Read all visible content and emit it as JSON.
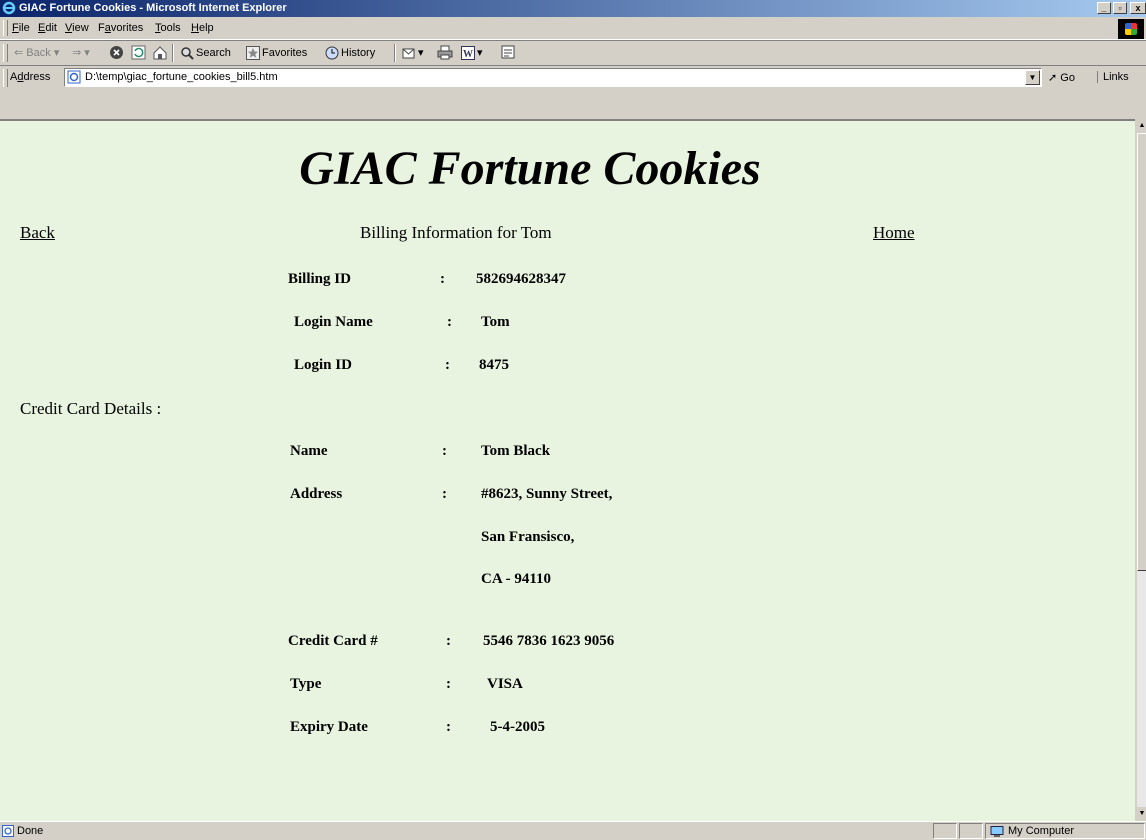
{
  "window": {
    "title": "GIAC Fortune Cookies - Microsoft Internet Explorer"
  },
  "menu": [
    {
      "accel": "F",
      "rest": "ile"
    },
    {
      "accel": "E",
      "rest": "dit"
    },
    {
      "accel": "V",
      "rest": "iew"
    },
    {
      "pre": "F",
      "accel": "a",
      "rest": "vorites"
    },
    {
      "accel": "T",
      "rest": "ools"
    },
    {
      "accel": "H",
      "rest": "elp"
    }
  ],
  "toolbar": {
    "back": "Back",
    "search": "Search",
    "favorites": "Favorites",
    "history": "History"
  },
  "address": {
    "label_accel": "d",
    "label_pre": "A",
    "label_rest": "dress",
    "url": "D:\\temp\\giac_fortune_cookies_bill5.htm",
    "go": "Go",
    "links": "Links"
  },
  "page": {
    "title": "GIAC Fortune Cookies",
    "back_link": "Back",
    "home_link": "Home",
    "heading": "Billing Information for Tom",
    "account": [
      {
        "label": "Billing ID",
        "value": "582694628347"
      },
      {
        "label": "Login Name",
        "value": "Tom"
      },
      {
        "label": "Login ID",
        "value": "8475"
      }
    ],
    "credit_section_label": "Credit Card Details :",
    "card": {
      "name_label": "Name",
      "name": "Tom Black",
      "address_label": "Address",
      "address_lines": [
        "#8623, Sunny Street,",
        "San Fransisco,",
        "CA - 94110"
      ],
      "number_label": "Credit Card #",
      "number": "5546 7836 1623 9056",
      "type_label": "Type",
      "type": "VISA",
      "expiry_label": "Expiry Date",
      "expiry": "5-4-2005"
    },
    "separator": ":"
  },
  "status": {
    "text": "Done",
    "zone": "My Computer"
  }
}
